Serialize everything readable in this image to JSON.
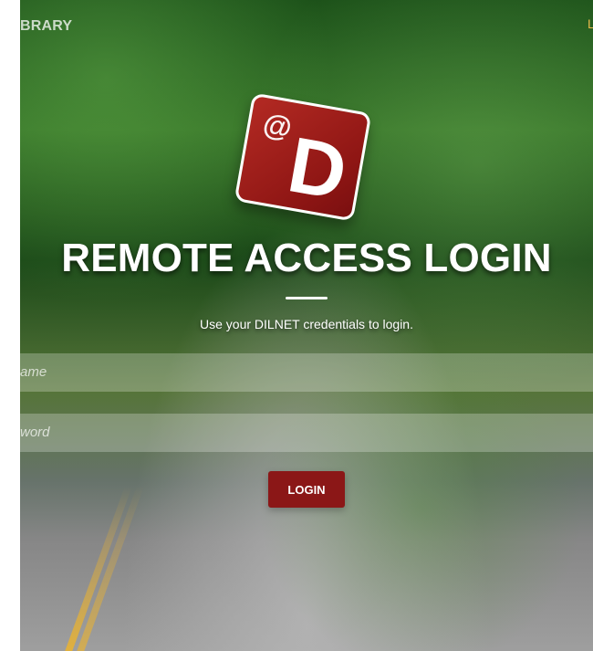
{
  "brand": {
    "left_text": "BRARY",
    "right_text": "L"
  },
  "logo": {
    "at_symbol": "@",
    "letter": "D"
  },
  "login": {
    "title": "REMOTE ACCESS LOGIN",
    "subtitle": "Use your DILNET credentials to login.",
    "username_placeholder": "ame",
    "password_placeholder": "word",
    "button_label": "LOGIN"
  },
  "colors": {
    "accent_red": "#8b1717"
  }
}
